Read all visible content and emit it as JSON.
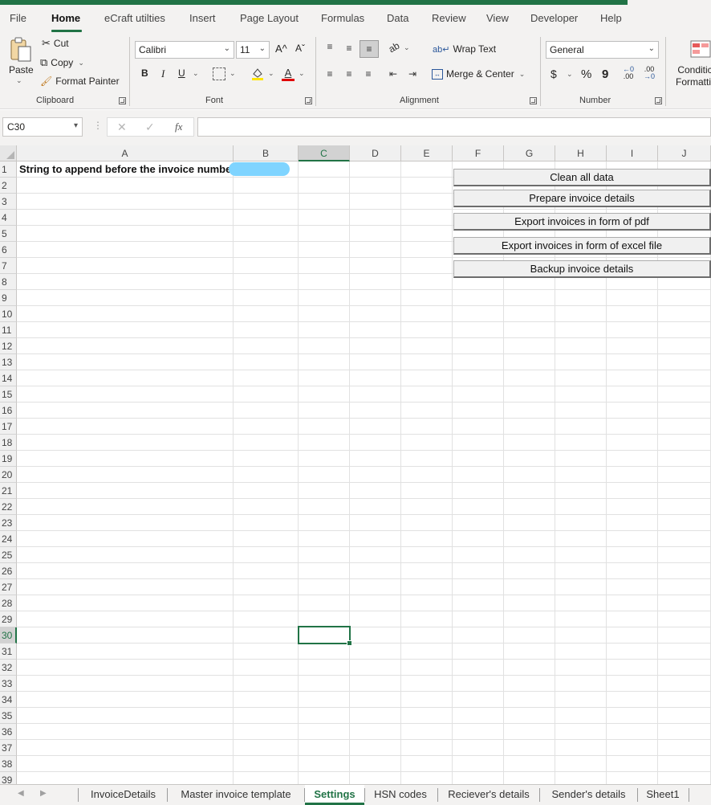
{
  "menu_tabs": [
    "File",
    "Home",
    "eCraft utilties",
    "Insert",
    "Page Layout",
    "Formulas",
    "Data",
    "Review",
    "View",
    "Developer",
    "Help"
  ],
  "active_tab": "Home",
  "ribbon": {
    "clipboard": {
      "paste": "Paste",
      "cut": "Cut",
      "copy": "Copy",
      "format_painter": "Format Painter",
      "label": "Clipboard"
    },
    "font": {
      "font_name": "Calibri",
      "font_size": "11",
      "bold": "B",
      "italic": "I",
      "underline": "U",
      "grow": "A^",
      "shrink": "Aˇ",
      "font_color_glyph": "A",
      "label": "Font"
    },
    "alignment": {
      "wrap_text": "Wrap Text",
      "merge_center": "Merge & Center",
      "label": "Alignment"
    },
    "number": {
      "format": "General",
      "currency": "$",
      "percent": "%",
      "comma": "9",
      "increase_decimal": ".00",
      "decrease_decimal": ".00",
      "label": "Number"
    },
    "styles": {
      "conditional_formatting_line1": "Conditic",
      "conditional_formatting_line2": "Formattir"
    }
  },
  "formula_bar": {
    "name_box": "C30",
    "cancel": "✕",
    "enter": "✓",
    "fx": "fx",
    "formula": ""
  },
  "columns": [
    "A",
    "B",
    "C",
    "D",
    "E",
    "F",
    "G",
    "H",
    "I",
    "J"
  ],
  "selected_column": "C",
  "rows": [
    "1",
    "2",
    "3",
    "4",
    "5",
    "6",
    "7",
    "8",
    "9",
    "10",
    "11",
    "12",
    "13",
    "14",
    "15",
    "16",
    "17",
    "18",
    "19",
    "20",
    "21",
    "22",
    "23",
    "24",
    "25",
    "26",
    "27",
    "28",
    "29",
    "30",
    "31",
    "32",
    "33",
    "34",
    "35",
    "36",
    "37",
    "38",
    "39"
  ],
  "selected_row": "30",
  "cells": {
    "A1": "String to append before the invoice number"
  },
  "macro_buttons": [
    "Clean all data",
    "Prepare invoice details",
    "Export invoices in form of pdf",
    "Export invoices in form of excel file",
    "Backup invoice details"
  ],
  "sheet_tabs": [
    "InvoiceDetails",
    "Master invoice template",
    "Settings",
    "HSN codes",
    "Reciever's details",
    "Sender's details",
    "Sheet1"
  ],
  "active_sheet": "Settings",
  "colors": {
    "accent": "#217346",
    "redaction": "#7fd4ff"
  }
}
